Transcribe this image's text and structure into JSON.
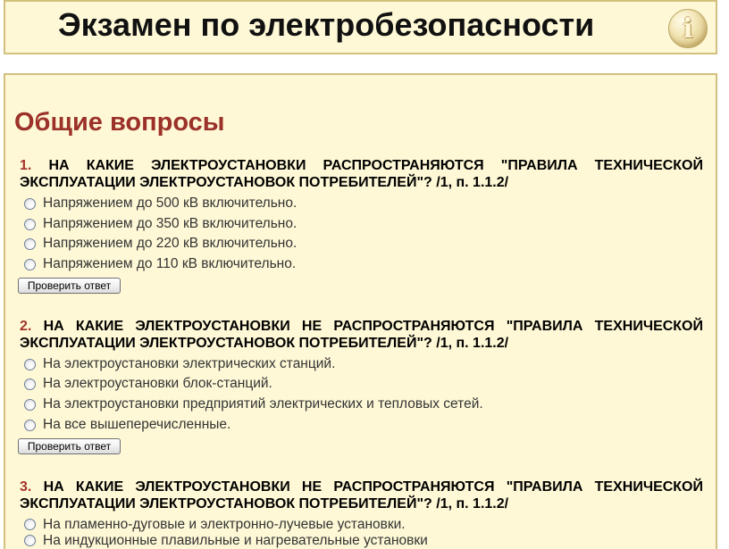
{
  "header": {
    "title": "Экзамен по электробезопасности",
    "info_icon": "info-icon"
  },
  "section": {
    "title": "Общие вопросы"
  },
  "questions": [
    {
      "number": "1.",
      "text": "НА КАКИЕ ЭЛЕКТРОУСТАНОВКИ РАСПРОСТРАНЯЮТСЯ \"ПРАВИЛА ТЕХНИЧЕСКОЙ ЭКСПЛУАТАЦИИ ЭЛЕКТРОУСТАНОВОК ПОТРЕБИТЕЛЕЙ\"? /1, п. 1.1.2/",
      "options": [
        "Напряжением до 500 кВ включительно.",
        "Напряжением до 350 кВ включительно.",
        "Напряжением до 220 кВ включительно.",
        "Напряжением до 110 кВ включительно."
      ],
      "check_label": "Проверить ответ"
    },
    {
      "number": "2.",
      "text": "НА КАКИЕ ЭЛЕКТРОУСТАНОВКИ НЕ РАСПРОСТРАНЯЮТСЯ \"ПРАВИЛА ТЕХНИЧЕСКОЙ ЭКСПЛУАТАЦИИ ЭЛЕКТРОУСТАНОВОК ПОТРЕБИТЕЛЕЙ\"? /1, п. 1.1.2/",
      "options": [
        "На электроустановки электрических станций.",
        "На электроустановки блок-станций.",
        "На электроустановки предприятий электрических и тепловых сетей.",
        "На все вышеперечисленные."
      ],
      "check_label": "Проверить ответ"
    },
    {
      "number": "3.",
      "text": "НА КАКИЕ ЭЛЕКТРОУСТАНОВКИ НЕ РАСПРОСТРАНЯЮТСЯ \"ПРАВИЛА ТЕХНИЧЕСКОЙ ЭКСПЛУАТАЦИИ ЭЛЕКТРОУСТАНОВОК ПОТРЕБИТЕЛЕЙ\"? /1, п. 1.1.2/",
      "options": [
        "На пламенно-дуговые и электронно-лучевые установки.",
        "На индукционные плавильные и нагревательные установки"
      ]
    }
  ],
  "icons": {
    "radio": "radio-unchecked-icon"
  },
  "colors": {
    "panel_bg": "#fef8d6",
    "border": "#d3c07e",
    "heading": "#9b3129",
    "number": "#a3342b",
    "option_text": "#333333"
  }
}
